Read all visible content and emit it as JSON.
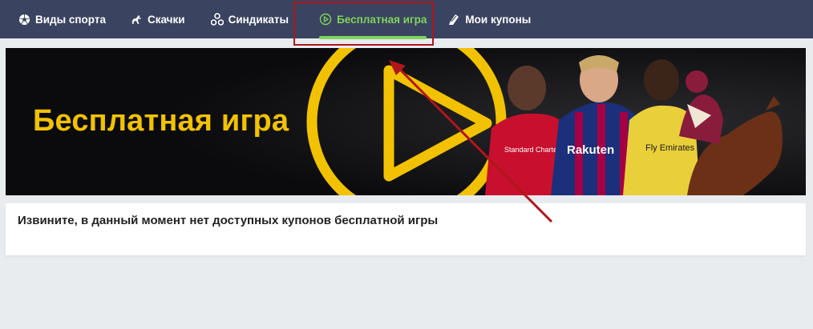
{
  "nav": {
    "items": [
      {
        "label": "Виды спорта",
        "icon": "soccer-ball-icon"
      },
      {
        "label": "Скачки",
        "icon": "horse-icon"
      },
      {
        "label": "Синдикаты",
        "icon": "syndicate-icon"
      },
      {
        "label": "Бесплатная игра",
        "icon": "play-circle-icon",
        "active": true
      },
      {
        "label": "Мои купоны",
        "icon": "coupon-icon"
      }
    ]
  },
  "banner": {
    "title": "Бесплатная игра",
    "player_texts": [
      "Rakuten",
      "Fly Emirates",
      "Standard Chartered"
    ]
  },
  "notice": {
    "text": "Извините, в данный момент нет доступных купонов бесплатной игры"
  },
  "colors": {
    "nav_bg": "#3a4360",
    "active": "#7fd35a",
    "brand_yellow": "#f2c200",
    "annotation_red": "#b0161b",
    "page_bg": "#e9ecef"
  }
}
